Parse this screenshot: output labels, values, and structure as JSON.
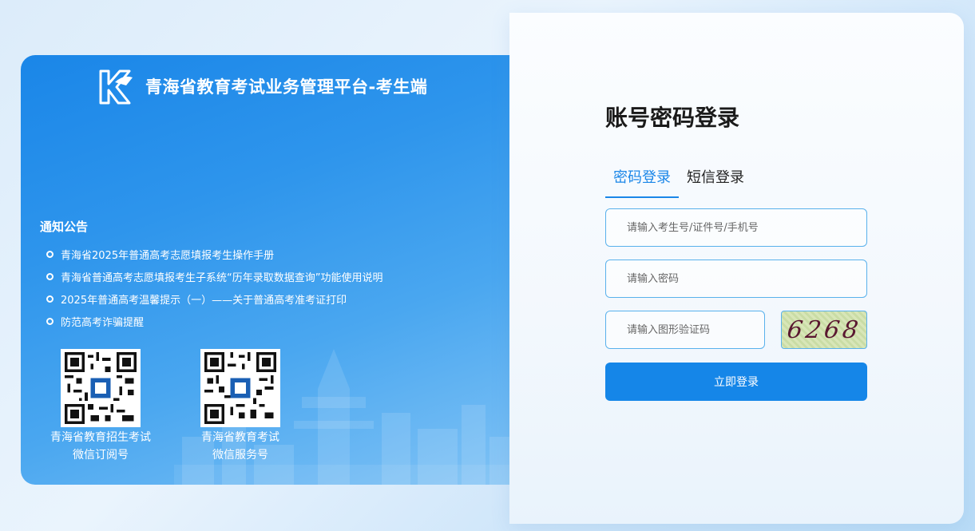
{
  "platform": {
    "title": "青海省教育考试业务管理平台-考生端",
    "logo_icon": "qh-edu-logo-icon"
  },
  "notice": {
    "title": "通知公告",
    "items": [
      "青海省2025年普通高考志愿填报考生操作手册",
      "青海省普通高考志愿填报考生子系统“历年录取数据查询”功能使用说明",
      "2025年普通高考温馨提示（一）——关于普通高考准考证打印",
      "防范高考诈骗提醒"
    ]
  },
  "qrcodes": [
    {
      "line1": "青海省教育招生考试",
      "line2": "微信订阅号"
    },
    {
      "line1": "青海省教育考试",
      "line2": "微信服务号"
    }
  ],
  "login": {
    "title": "账号密码登录",
    "tabs": [
      "密码登录",
      "短信登录"
    ],
    "active_tab": "密码登录",
    "username_placeholder": "请输入考生号/证件号/手机号",
    "password_placeholder": "请输入密码",
    "captcha_placeholder": "请输入图形验证码",
    "captcha_text": "6268",
    "submit_label": "立即登录"
  },
  "colors": {
    "accent": "#1586e8",
    "panel_blue": "#1a86e8",
    "input_border": "#59b1ec"
  }
}
